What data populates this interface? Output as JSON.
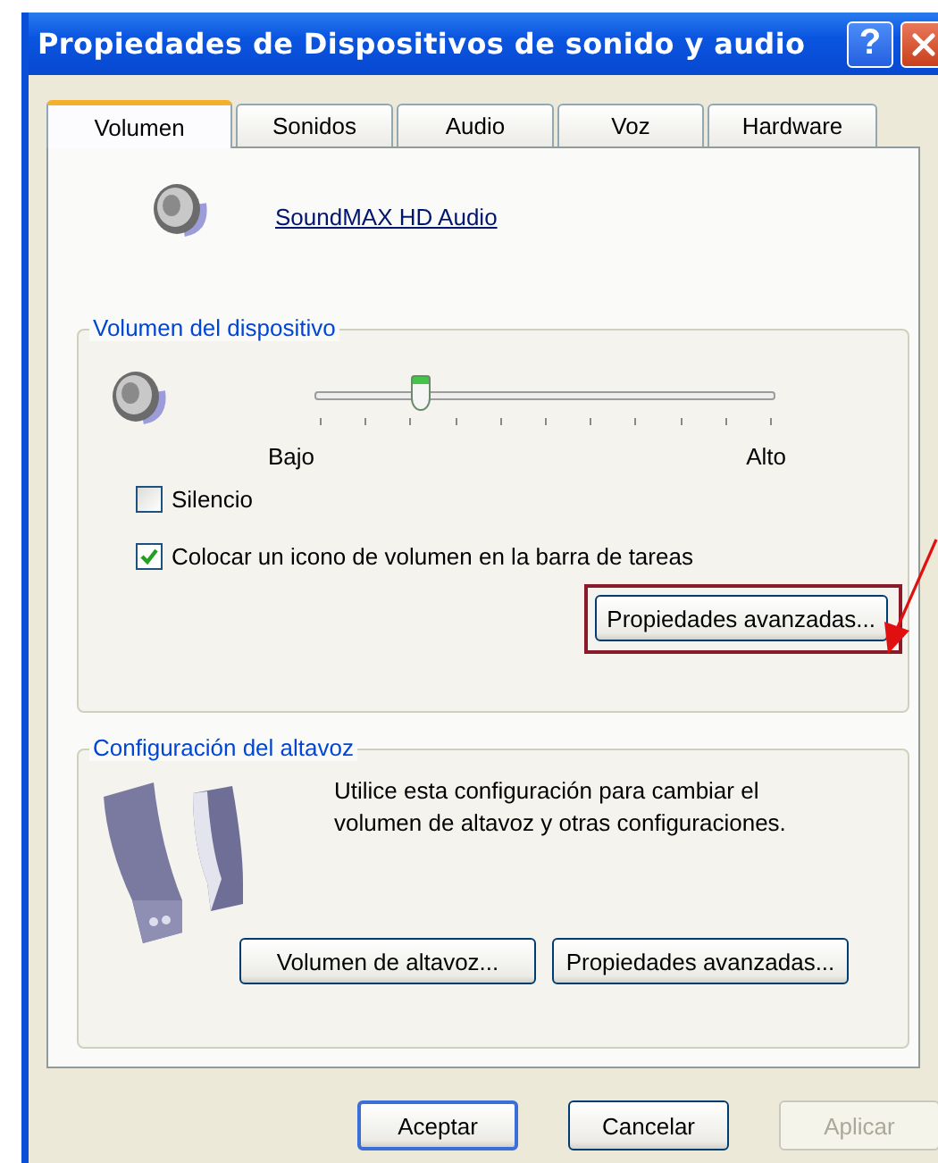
{
  "window": {
    "title": "Propiedades de Dispositivos de sonido y audio",
    "help_button": "?"
  },
  "tabs": [
    {
      "label": "Volumen",
      "selected": true
    },
    {
      "label": "Sonidos",
      "selected": false
    },
    {
      "label": "Audio",
      "selected": false
    },
    {
      "label": "Voz",
      "selected": false
    },
    {
      "label": "Hardware",
      "selected": false
    }
  ],
  "device": {
    "name": "SoundMAX HD Audio"
  },
  "volume_group": {
    "title": "Volumen del dispositivo",
    "slider": {
      "level": 0.23,
      "min_label": "Bajo",
      "max_label": "Alto"
    },
    "checkboxes": [
      {
        "label": "Silencio",
        "checked": false
      },
      {
        "label": "Colocar un icono de volumen en la barra de tareas",
        "checked": true
      }
    ],
    "button": "Propiedades avanzadas..."
  },
  "speaker_group": {
    "title": "Configuración del altavoz",
    "description": "Utilice esta configuración para cambiar el volumen de altavoz  y otras configuraciones.",
    "buttons": [
      "Volumen de altavoz...",
      "Propiedades avanzadas..."
    ]
  },
  "footer_buttons": [
    {
      "label": "Aceptar",
      "default": true,
      "disabled": false
    },
    {
      "label": "Cancelar",
      "default": false,
      "disabled": false
    },
    {
      "label": "Aplicar",
      "default": false,
      "disabled": true
    }
  ]
}
